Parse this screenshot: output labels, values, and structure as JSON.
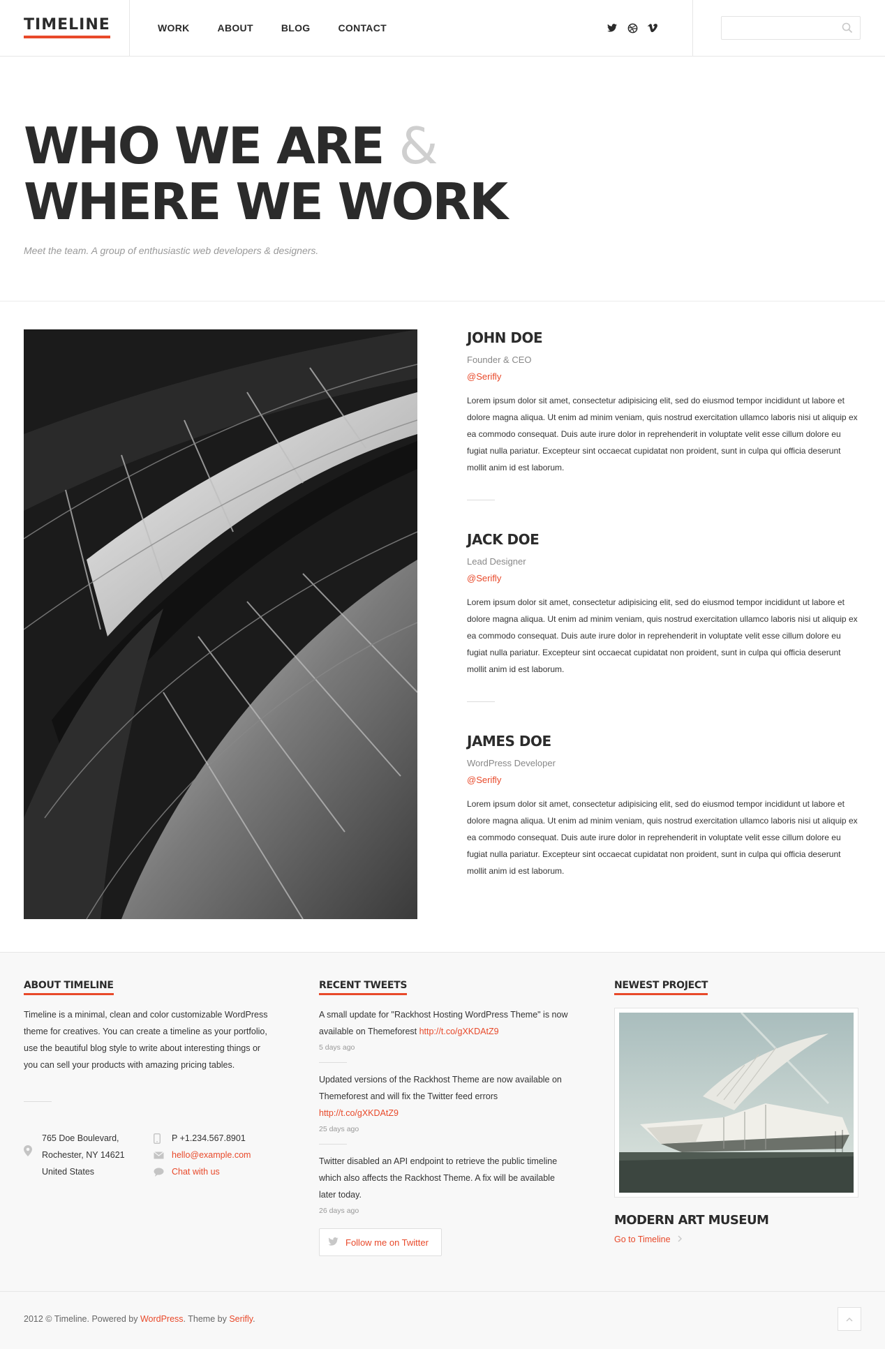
{
  "header": {
    "logo": "TIMELINE",
    "nav": [
      "WORK",
      "ABOUT",
      "BLOG",
      "CONTACT"
    ],
    "social_icons": [
      "twitter-icon",
      "dribbble-icon",
      "vimeo-icon"
    ],
    "search_placeholder": ""
  },
  "hero": {
    "title_line1": "WHO WE ARE",
    "title_amp": "&",
    "title_line2": "WHERE WE WORK",
    "subtitle": "Meet the team. A group of enthusiastic web developers & designers."
  },
  "team": {
    "members": [
      {
        "name": "JOHN DOE",
        "role": "Founder & CEO",
        "handle": "@Serifly",
        "bio": "Lorem ipsum dolor sit amet, consectetur adipisicing elit, sed do eiusmod tempor incididunt ut labore et dolore magna aliqua. Ut enim ad minim veniam, quis nostrud exercitation ullamco laboris nisi ut aliquip ex ea commodo consequat. Duis aute irure dolor in reprehenderit in voluptate velit esse cillum dolore eu fugiat nulla pariatur. Excepteur sint occaecat cupidatat non proident, sunt in culpa qui officia deserunt mollit anim id est laborum."
      },
      {
        "name": "JACK DOE",
        "role": "Lead Designer",
        "handle": "@Serifly",
        "bio": "Lorem ipsum dolor sit amet, consectetur adipisicing elit, sed do eiusmod tempor incididunt ut labore et dolore magna aliqua. Ut enim ad minim veniam, quis nostrud exercitation ullamco laboris nisi ut aliquip ex ea commodo consequat. Duis aute irure dolor in reprehenderit in voluptate velit esse cillum dolore eu fugiat nulla pariatur. Excepteur sint occaecat cupidatat non proident, sunt in culpa qui officia deserunt mollit anim id est laborum."
      },
      {
        "name": "JAMES DOE",
        "role": "WordPress Developer",
        "handle": "@Serifly",
        "bio": "Lorem ipsum dolor sit amet, consectetur adipisicing elit, sed do eiusmod tempor incididunt ut labore et dolore magna aliqua. Ut enim ad minim veniam, quis nostrud exercitation ullamco laboris nisi ut aliquip ex ea commodo consequat. Duis aute irure dolor in reprehenderit in voluptate velit esse cillum dolore eu fugiat nulla pariatur. Excepteur sint occaecat cupidatat non proident, sunt in culpa qui officia deserunt mollit anim id est laborum."
      }
    ]
  },
  "footer": {
    "about": {
      "title": "ABOUT TIMELINE",
      "text": "Timeline is a minimal, clean and color customizable WordPress theme for creatives. You can create a timeline as your portfolio, use the beautiful blog style to write about interesting things or you can sell your products with amazing pricing tables.",
      "address": [
        "765 Doe Boulevard,",
        "Rochester, NY 14621",
        "United States"
      ],
      "phone": "P +1.234.567.8901",
      "email": "hello@example.com",
      "chat": "Chat with us"
    },
    "tweets": {
      "title": "RECENT TWEETS",
      "items": [
        {
          "text": "A small update for \"Rackhost Hosting WordPress Theme\" is now available on Themeforest ",
          "link": "http://t.co/gXKDAtZ9",
          "ago": "5 days ago"
        },
        {
          "text": "Updated versions of the Rackhost Theme are now available on Themeforest and will fix the Twitter feed errors ",
          "link": "http://t.co/gXKDAtZ9",
          "ago": "25 days ago"
        },
        {
          "text": "Twitter disabled an API endpoint to retrieve the public timeline which also affects the Rackhost Theme. A fix will be available later today.",
          "link": "",
          "ago": "26 days ago"
        }
      ],
      "follow_label": "Follow me on Twitter"
    },
    "project": {
      "title": "NEWEST PROJECT",
      "name": "MODERN ART MUSEUM",
      "link_label": "Go to Timeline"
    }
  },
  "bottom": {
    "copy_prefix": "2012 © Timeline. Powered by ",
    "wordpress": "WordPress",
    "theme_by": ". Theme by ",
    "serifly": "Serifly",
    "end": "."
  },
  "colors": {
    "accent": "#e8492a",
    "dark": "#2b2b2b"
  }
}
